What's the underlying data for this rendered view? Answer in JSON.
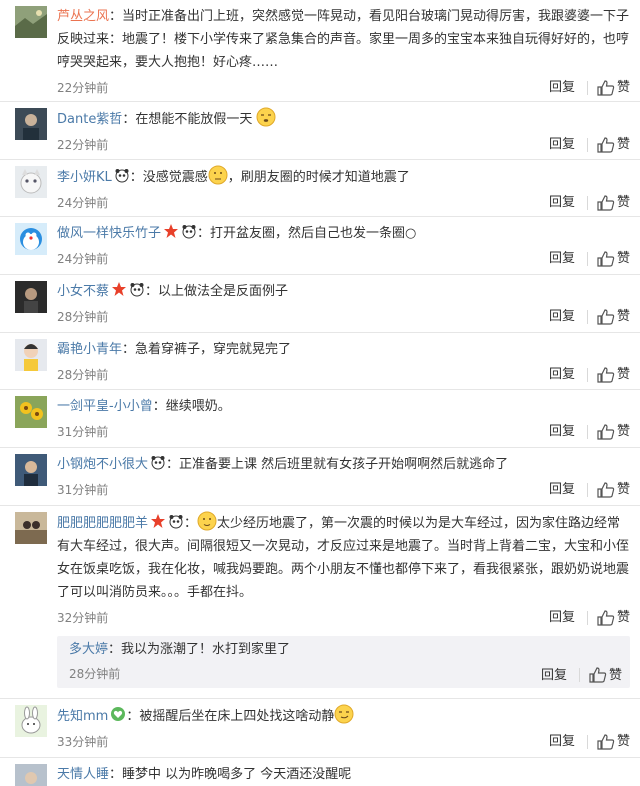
{
  "comments": [
    {
      "user": "芦丛之风",
      "text": "：当时正准备出门上班，突然感觉一阵晃动，看见阳台玻璃门晃动得厉害，我跟婆婆一下子反映过来：地震了！楼下小学传来了紧急集合的声音。家里一周多的宝宝本来独自玩得好好的，也哼哼哭哭起来，要大人抱抱！好心疼……",
      "time": "22分钟前"
    },
    {
      "user": "Dante紫哲",
      "text": "：在想能不能放假一天",
      "time": "22分钟前"
    },
    {
      "user": "李小妍KL",
      "text": "：没感觉震感",
      "text2": "，刷朋友圈的时候才知道地震了",
      "time": "24分钟前"
    },
    {
      "user": "做风一样快乐竹子",
      "text": "：打开盆友圈，然后自己也发一条圈○",
      "time": "24分钟前"
    },
    {
      "user": "小女不蔡",
      "text": "：以上做法全是反面例子",
      "time": "28分钟前"
    },
    {
      "user": "霸艳小青年",
      "text": "：急着穿裤子，穿完就晃完了",
      "time": "28分钟前"
    },
    {
      "user": "一剑平皇-小小曾",
      "text": "：继续喂奶。",
      "time": "31分钟前"
    },
    {
      "user": "小钢炮不小很大",
      "text": "：正准备要上课 然后班里就有女孩子开始啊啊然后就逃命了",
      "time": "31分钟前"
    },
    {
      "user": "肥肥肥肥肥肥羊",
      "text": "太少经历地震了，第一次震的时候以为是大车经过，因为家住路边经常有大车经过，很大声。间隔很短又一次晃动，才反应过来是地震了。当时背上背着二宝，大宝和小侄女在饭桌吃饭，我在化妆，喊我妈要跑。两个小朋友不懂也都停下来了，看我很紧张，跟奶奶说地震了可以叫消防员来。。。手都在抖。",
      "time": "32分钟前",
      "reply": {
        "user": "多大婷",
        "text": "：我以为涨潮了！水打到家里了",
        "time": "28分钟前"
      }
    },
    {
      "user": "先知mm",
      "text": "：被摇醒后坐在床上四处找这啥动静",
      "time": "33分钟前"
    },
    {
      "user": "天情人睡",
      "text": "：睡梦中 以为昨晚喝多了 今天酒还没醒呢",
      "time": ""
    }
  ],
  "actions": {
    "reply": "回复",
    "like": "赞"
  },
  "colors": {
    "username": "#eb7350",
    "username_alt": "#4b7aa8",
    "time": "#808080",
    "text": "#333333"
  }
}
